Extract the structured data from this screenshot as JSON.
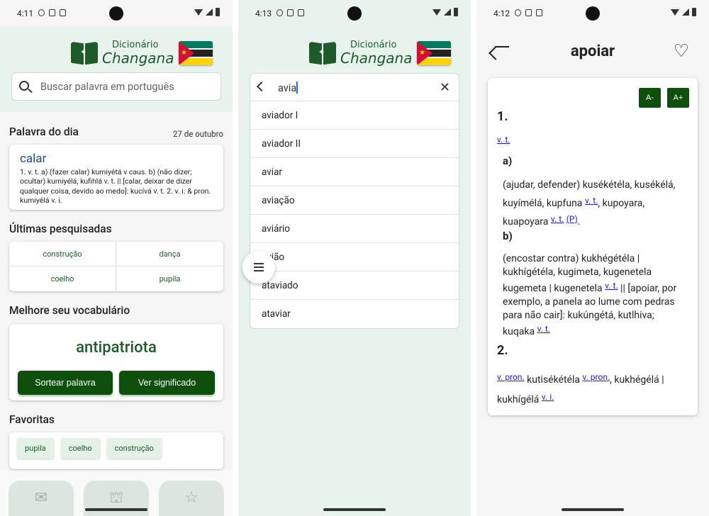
{
  "phone1": {
    "status": {
      "time": "4:11"
    },
    "header": {
      "logo_line1": "Dicionário",
      "logo_line2": "Changana"
    },
    "search": {
      "placeholder": "Buscar palavra em português"
    },
    "word_of_day": {
      "title": "Palavra do dia",
      "date": "27 de outubro",
      "word": "calar",
      "definition": "1. v. t. a) (fazer calar) kumiyétá v caus. b) (não dizer; ocultar) kumiyélá, kufihlá v. t. || [calar, deixar de dizer qualquer coisa, devido ao medo]: kucívá v. t. 2. v. i. & pron. kumiyélá v. i."
    },
    "recent": {
      "title": "Últimas pesquisadas",
      "items": [
        "construção",
        "dança",
        "coelho",
        "pupila"
      ]
    },
    "vocab": {
      "title": "Melhore seu vocabulário",
      "word": "antipatriota",
      "random_label": "Sortear palavra",
      "meaning_label": "Ver significado"
    },
    "favorites": {
      "title": "Favoritas",
      "items": [
        "pupila",
        "coelho",
        "construção"
      ]
    },
    "nav": [
      {
        "icon": "mail-icon"
      },
      {
        "icon": "hands-icon"
      },
      {
        "icon": "star-icon"
      }
    ]
  },
  "phone2": {
    "status": {
      "time": "4:13"
    },
    "header": {
      "logo_line1": "Dicionário",
      "logo_line2": "Changana"
    },
    "query": "avia",
    "suggestions": [
      "aviador I",
      "aviador II",
      "aviar",
      "aviação",
      "aviário",
      "avião",
      "ataviado",
      "ataviar"
    ]
  },
  "phone3": {
    "status": {
      "time": "4:12"
    },
    "title": "apoiar",
    "font_decrease": "A-",
    "font_increase": "A+",
    "sense1": {
      "num": "1.",
      "pos": "v. t.",
      "a_label": "a)",
      "a_text1": "(ajudar, defender) kusékétéla, kusékélá, kuyímélá, kupfuna",
      "a_pos1": "v. t.",
      "a_text2": ", kupoyara,",
      "a_text3": "kuapoyara",
      "a_pos2": "v. t.",
      "a_pos3": "(P)",
      "b_label": "b)",
      "b_text1": "(encostar contra) kukhégétéla | kukhígétéla, kugimeta, kugenetela kugemeta | kugenetela",
      "b_pos1": "v. t.",
      "b_text2": "|| [apoiar, por exemplo, a panela ao lume com pedras para não cair]: kukúngétá, kutlhiva; kuqaka",
      "b_pos2": "v. t."
    },
    "sense2": {
      "num": "2.",
      "pos1": "v. pron.",
      "text1": "kutisékétéla",
      "pos2": "v. pron.",
      "text2": ", kukhégélá | kukhígélá",
      "pos3": "v. i."
    }
  },
  "colors": {
    "brand_green": "#0e4f0e",
    "header_bg": "#e7f3ec",
    "link_blue": "#1a1ae6",
    "word_blue": "#1d4b8f"
  }
}
